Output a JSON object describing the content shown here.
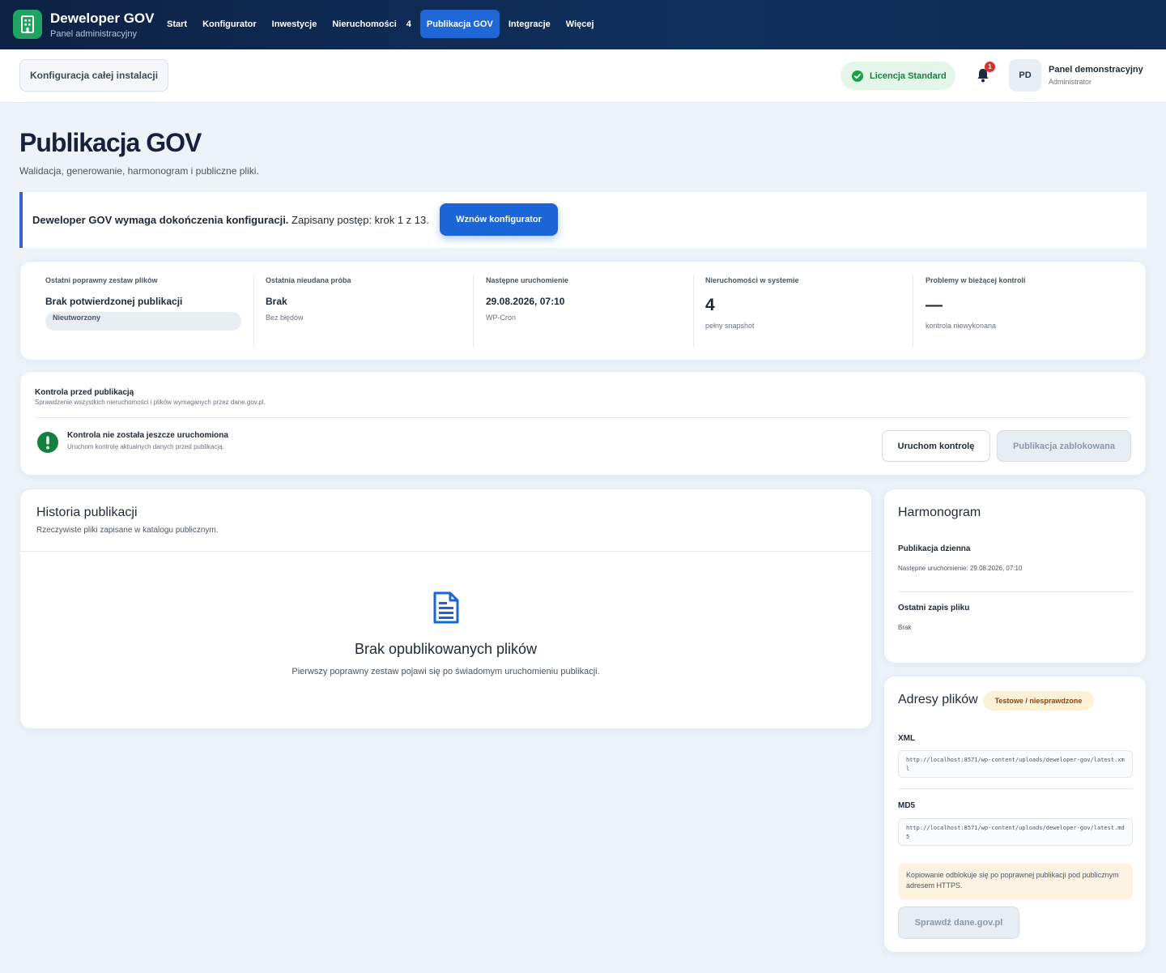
{
  "app": {
    "title": "Deweloper GOV",
    "subtitle": "Panel administracyjny"
  },
  "nav": {
    "items": [
      {
        "label": "Start"
      },
      {
        "label": "Konfigurator"
      },
      {
        "label": "Inwestycje"
      },
      {
        "label": "Nieruchomości",
        "badge": "4"
      },
      {
        "label": "Publikacja GOV",
        "active": true
      },
      {
        "label": "Integracje"
      },
      {
        "label": "Więcej"
      }
    ]
  },
  "subbar": {
    "install_button": "Konfiguracja całej instalacji",
    "license": "Licencja Standard",
    "notification_count": "1",
    "user_initials": "PD",
    "user_name": "Panel demonstracyjny",
    "user_role": "Administrator"
  },
  "page": {
    "title": "Publikacja GOV",
    "subtitle": "Walidacja, generowanie, harmonogram i publiczne pliki."
  },
  "alert": {
    "bold": "Deweloper GOV wymaga dokończenia konfiguracji.",
    "text": "Zapisany postęp: krok 1 z 13.",
    "button": "Wznów konfigurator"
  },
  "stats": [
    {
      "label": "Ostatni poprawny zestaw plików",
      "value": "Brak potwierdzonej publikacji",
      "pill": "Nieutworzony"
    },
    {
      "label": "Ostatnia nieudana próba",
      "value": "Brak",
      "note": "Bez błędów"
    },
    {
      "label": "Następne uruchomienie",
      "value": "29.08.2026, 07:10",
      "note": "WP-Cron"
    },
    {
      "label": "Nieruchomości w systemie",
      "value": "4",
      "note": "pełny snapshot"
    },
    {
      "label": "Problemy w bieżącej kontroli",
      "value": "—",
      "note": "kontrola niewykonana"
    }
  ],
  "precheck": {
    "title": "Kontrola przed publikacją",
    "subtitle": "Sprawdzenie wszystkich nieruchomości i plików wymaganych przez dane.gov.pl.",
    "status": "Kontrola nie została jeszcze uruchomiona",
    "status_sub": "Uruchom kontrolę aktualnych danych przed publikacją.",
    "run_button": "Uruchom kontrolę",
    "blocked_button": "Publikacja zablokowana"
  },
  "history": {
    "title": "Historia publikacji",
    "subtitle": "Rzeczywiste pliki zapisane w katalogu publicznym.",
    "empty_title": "Brak opublikowanych plików",
    "empty_sub": "Pierwszy poprawny zestaw pojawi się po świadomym uruchomieniu publikacji."
  },
  "schedule": {
    "title": "Harmonogram",
    "daily_label": "Publikacja dzienna",
    "daily_note": "Następne uruchomienie: 29.08.2026, 07:10",
    "last_label": "Ostatni zapis pliku",
    "last_note": "Brak"
  },
  "files": {
    "title": "Adresy plików",
    "badge": "Testowe / niesprawdzone",
    "xml_label": "XML",
    "xml_url": "http://localhost:8571/wp-content/uploads/deweloper-gov/latest.xml",
    "md5_label": "MD5",
    "md5_url": "http://localhost:8571/wp-content/uploads/deweloper-gov/latest.md5",
    "notice": "Kopiowanie odblokuje się po poprawnej publikacji pod publicznym adresem HTTPS.",
    "check_button": "Sprawdź dane.gov.pl"
  },
  "colors": {
    "navy": "#0d2244",
    "accent": "#1a66d6",
    "green": "#1fa561",
    "warning_bg": "#fdf3e3"
  }
}
